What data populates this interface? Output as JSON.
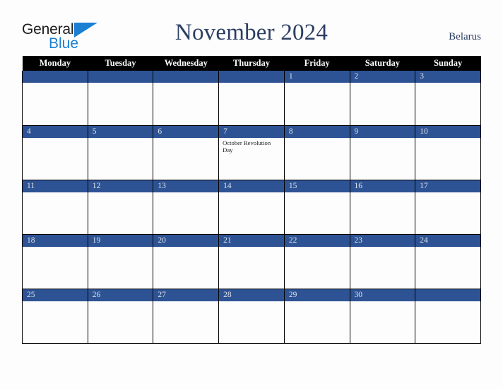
{
  "brand": {
    "word1": "General",
    "word2": "Blue",
    "triangle_color": "#1b7fd4",
    "word1_color": "#1d1d1d",
    "word2_color": "#1b7fd4"
  },
  "header": {
    "title": "November 2024",
    "region": "Belarus",
    "title_color": "#2c3e63"
  },
  "colors": {
    "header_row_bg": "#000000",
    "header_row_text": "#ffffff",
    "date_bar_bg": "#2e5394",
    "date_bar_text": "#dfe3ea",
    "cell_bg": "#fdfdfd",
    "grid_line": "#000000",
    "page_bg": "#fdfdfd"
  },
  "calendar": {
    "month": "November",
    "year": "2024",
    "weekday_headers": [
      "Monday",
      "Tuesday",
      "Wednesday",
      "Thursday",
      "Friday",
      "Saturday",
      "Sunday"
    ],
    "weeks": [
      [
        {
          "date": "",
          "events": []
        },
        {
          "date": "",
          "events": []
        },
        {
          "date": "",
          "events": []
        },
        {
          "date": "",
          "events": []
        },
        {
          "date": "1",
          "events": []
        },
        {
          "date": "2",
          "events": []
        },
        {
          "date": "3",
          "events": []
        }
      ],
      [
        {
          "date": "4",
          "events": []
        },
        {
          "date": "5",
          "events": []
        },
        {
          "date": "6",
          "events": []
        },
        {
          "date": "7",
          "events": [
            "October Revolution Day"
          ]
        },
        {
          "date": "8",
          "events": []
        },
        {
          "date": "9",
          "events": []
        },
        {
          "date": "10",
          "events": []
        }
      ],
      [
        {
          "date": "11",
          "events": []
        },
        {
          "date": "12",
          "events": []
        },
        {
          "date": "13",
          "events": []
        },
        {
          "date": "14",
          "events": []
        },
        {
          "date": "15",
          "events": []
        },
        {
          "date": "16",
          "events": []
        },
        {
          "date": "17",
          "events": []
        }
      ],
      [
        {
          "date": "18",
          "events": []
        },
        {
          "date": "19",
          "events": []
        },
        {
          "date": "20",
          "events": []
        },
        {
          "date": "21",
          "events": []
        },
        {
          "date": "22",
          "events": []
        },
        {
          "date": "23",
          "events": []
        },
        {
          "date": "24",
          "events": []
        }
      ],
      [
        {
          "date": "25",
          "events": []
        },
        {
          "date": "26",
          "events": []
        },
        {
          "date": "27",
          "events": []
        },
        {
          "date": "28",
          "events": []
        },
        {
          "date": "29",
          "events": []
        },
        {
          "date": "30",
          "events": []
        },
        {
          "date": "",
          "events": []
        }
      ]
    ]
  }
}
